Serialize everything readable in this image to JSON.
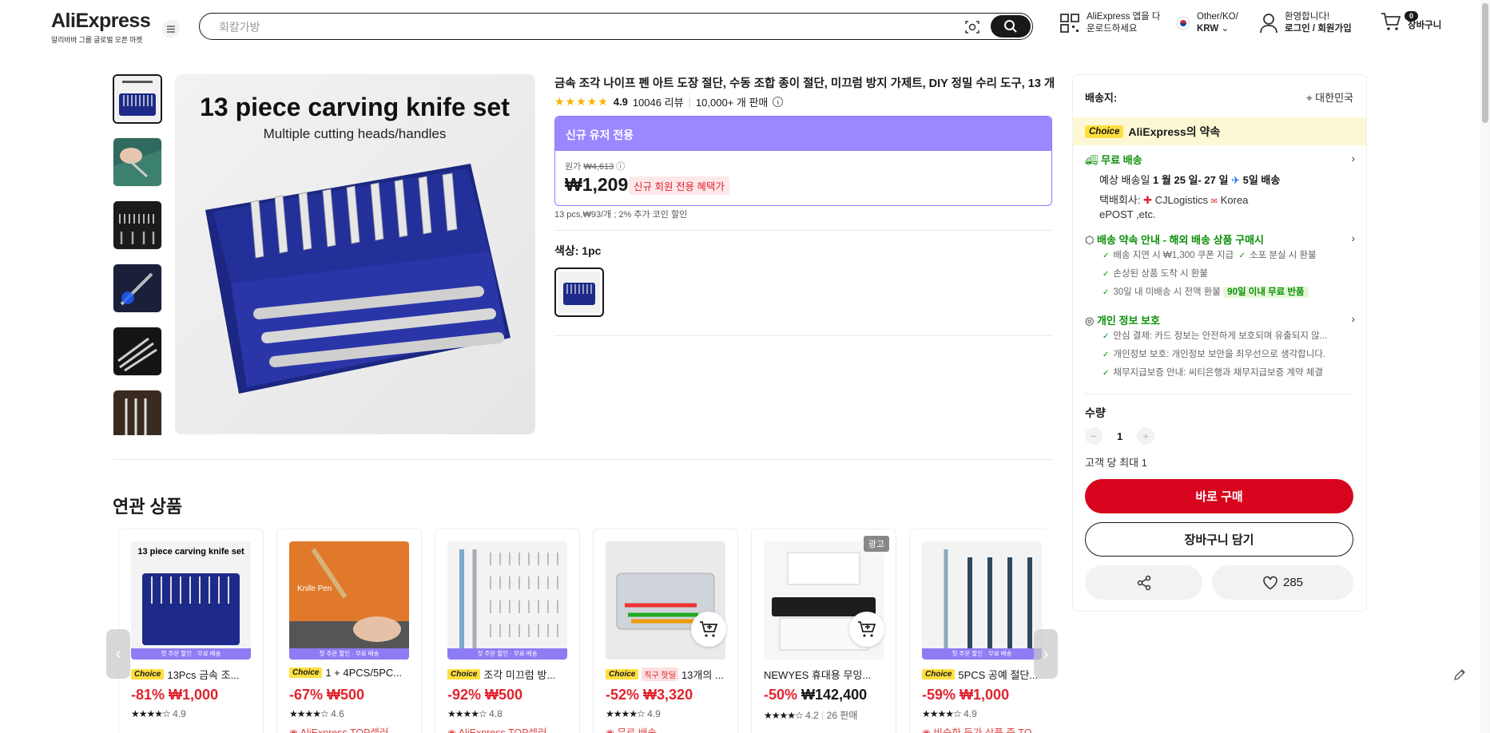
{
  "header": {
    "logo": "AliExpress",
    "logo_sub": "알리바바 그룹 글로벌 오픈 마켓",
    "search_placeholder": "회칼가방",
    "app_line1": "AliExpress 앱을 다",
    "app_line2": "운로드하세요",
    "region_line1": "Other/KO/",
    "region_line2": "KRW",
    "account_line1": "환영합니다!",
    "account_line2": "로그인 / 회원가입",
    "cart_count": "0",
    "cart_label": "장바구니"
  },
  "gallery": {
    "main_title": "13 piece carving knife set",
    "main_subtitle": "Multiple cutting heads/handles"
  },
  "product": {
    "title": "금속 조각 나이프 펜 아트 도장 절단, 수동 조합 종이 절단, 미끄럼 방지 가제트, DIY 정밀 수리 도구, 13 개",
    "stars": "★★★★★",
    "rating": "4.9",
    "reviews": "10046 리뷰",
    "sold": "10,000+ 개 판매",
    "promo_head": "신규 유저 전용",
    "orig_label": "원가",
    "orig_price": "₩4,613",
    "price": "₩1,209",
    "price_tag": "신규 회원 전용 혜택가",
    "unit_price": "13 pcs,₩93/개 ; 2% 추가 코인 할인",
    "color_label": "색상: 1pc"
  },
  "side": {
    "ship_to": "배송지:",
    "ship_location": "대한민국",
    "choice_badge": "Choice",
    "choice_promise": "AliExpress의 약속",
    "free_shipping": "무료 배송",
    "delivery_prefix": "예상 배송일",
    "delivery_dates": "1 월 25 일- 27 일",
    "delivery_days": "5일 배송",
    "carrier_label": "택배회사:",
    "carrier1": "CJLogistics",
    "carrier2": "Korea",
    "carrier3": "ePOST ,etc.",
    "promise_title": "배송 약속 안내 - 해외 배송 상품 구매시",
    "promise1": "배송 지연 시 ₩1,300 쿠폰 지급",
    "promise2": "소포 분실 시 환불",
    "promise3": "손상된 상품 도착 시 환불",
    "promise4": "30일 내 미배송 시 전액 환불",
    "promise4_tag": "90일 이내 무료 반품",
    "privacy_title": "개인 정보 보호",
    "privacy1": "안심 결제: 카드 정보는 안전하게 보호되며 유출되지 않...",
    "privacy2": "개인정보 보호: 개인정보 보안을 최우선으로 생각합니다.",
    "privacy3": "채무지급보증 안내: 씨티은행과 채무지급보증 계약 체결",
    "qty_label": "수량",
    "qty_minus": "−",
    "qty_value": "1",
    "qty_plus": "+",
    "qty_max": "고객 당 최대 1",
    "buy_now": "바로 구매",
    "add_cart": "장바구니 담기",
    "wishlist_count": "285"
  },
  "related": {
    "title": "연관 상품",
    "strip_text": "첫 주문 할인 · 무료 배송",
    "ad_label": "광고",
    "prev": "‹",
    "next": "›",
    "items": [
      {
        "choice": "Choice",
        "hot": "",
        "title": "13Pcs 금속 조...",
        "discount": "-81%",
        "price": "₩1,000",
        "stars": "★★★★☆",
        "rating": "4.9",
        "sold": "",
        "extra": ""
      },
      {
        "choice": "Choice",
        "hot": "",
        "title": "1 + 4PCS/5PC...",
        "discount": "-67%",
        "price": "₩500",
        "stars": "★★★★☆",
        "rating": "4.6",
        "sold": "",
        "extra": "AliExpress TOP셀러"
      },
      {
        "choice": "Choice",
        "hot": "",
        "title": "조각 미끄럼 방...",
        "discount": "-92%",
        "price": "₩500",
        "stars": "★★★★☆",
        "rating": "4.8",
        "sold": "",
        "extra": "AliExpress TOP셀러"
      },
      {
        "choice": "Choice",
        "hot": "직구 핫딜",
        "title": "13개의 ...",
        "discount": "-52%",
        "price": "₩3,320",
        "stars": "★★★★☆",
        "rating": "4.9",
        "sold": "",
        "extra": "무료 배송"
      },
      {
        "choice": "",
        "hot": "",
        "title": "NEWYES 휴대용 무잉...",
        "discount": "-50%",
        "price": "₩142,400",
        "stars": "★★★★☆",
        "rating": "4.2",
        "sold": "26 판매",
        "extra": ""
      },
      {
        "choice": "Choice",
        "hot": "",
        "title": "5PCS 공예 절단...",
        "discount": "-59%",
        "price": "₩1,000",
        "stars": "★★★★☆",
        "rating": "4.9",
        "sold": "",
        "extra": "비슷한 등가 상품 중 TO"
      }
    ]
  }
}
